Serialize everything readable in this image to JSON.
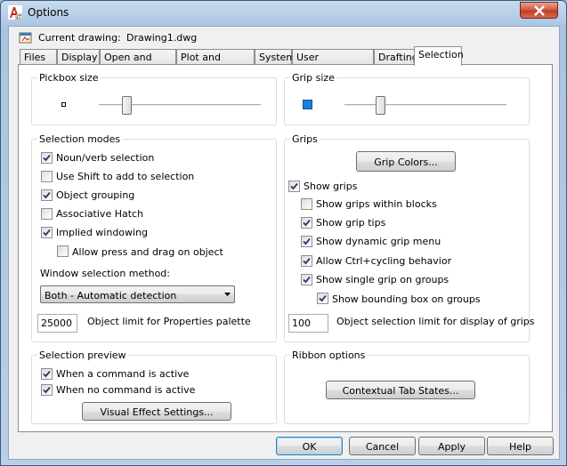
{
  "window": {
    "title": "Options"
  },
  "header": {
    "current_drawing_label": "Current drawing:",
    "current_drawing_value": "Drawing1.dwg"
  },
  "tabs": [
    "Files",
    "Display",
    "Open and Save",
    "Plot and Publish",
    "System",
    "User Preferences",
    "Drafting",
    "Selection"
  ],
  "active_tab": "Selection",
  "pickbox": {
    "title": "Pickbox size",
    "level": 0.17
  },
  "gripsize": {
    "title": "Grip size",
    "level": 0.22,
    "grip_color": "#1e7fe0"
  },
  "selection_modes": {
    "title": "Selection modes",
    "options": [
      {
        "label": "Noun/verb selection",
        "checked": true
      },
      {
        "label": "Use Shift to add to selection",
        "checked": false
      },
      {
        "label": "Object grouping",
        "checked": true
      },
      {
        "label": "Associative Hatch",
        "checked": false
      },
      {
        "label": "Implied windowing",
        "checked": true
      },
      {
        "label": "Allow press and drag on object",
        "checked": false
      }
    ],
    "window_method_label": "Window selection method:",
    "window_method_value": "Both - Automatic detection",
    "object_limit_value": "25000",
    "object_limit_label": "Object limit for Properties palette"
  },
  "grips": {
    "title": "Grips",
    "grip_colors_button": "Grip Colors...",
    "options": [
      {
        "label": "Show grips",
        "checked": true
      },
      {
        "label": "Show grips within blocks",
        "checked": false
      },
      {
        "label": "Show grip tips",
        "checked": true
      },
      {
        "label": "Show dynamic grip menu",
        "checked": true
      },
      {
        "label": "Allow Ctrl+cycling behavior",
        "checked": true
      },
      {
        "label": "Show single grip on groups",
        "checked": true
      },
      {
        "label": "Show bounding box on groups",
        "checked": true
      }
    ],
    "selection_limit_value": "100",
    "selection_limit_label": "Object selection limit for display of grips"
  },
  "selection_preview": {
    "title": "Selection preview",
    "options": [
      {
        "label": "When a command is active",
        "checked": true
      },
      {
        "label": "When no command is active",
        "checked": true
      }
    ],
    "visual_effect_button": "Visual Effect Settings..."
  },
  "ribbon_options": {
    "title": "Ribbon options",
    "contextual_button": "Contextual Tab States..."
  },
  "footer": {
    "ok": "OK",
    "cancel": "Cancel",
    "apply": "Apply",
    "help": "Help"
  }
}
